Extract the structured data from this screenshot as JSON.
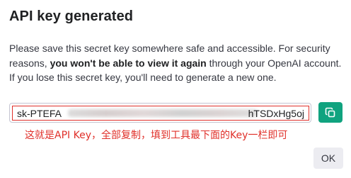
{
  "dialog": {
    "title": "API key generated",
    "description": {
      "part1": "Please save this secret key somewhere safe and accessible. For security reasons, ",
      "bold": "you won't be able to view it again",
      "part2": " through your OpenAI account. If you lose this secret key, you'll need to generate a new one."
    },
    "key": {
      "visible_prefix": "sk-PTEFA",
      "visible_suffix": "hTSDxHg5oj",
      "redacted": true
    },
    "copy_button": {
      "icon": "copy-icon"
    },
    "annotation": "这就是API Key，全部复制，填到工具最下面的Key一栏即可",
    "ok_label": "OK"
  },
  "colors": {
    "accent": "#10a37f",
    "highlight_red": "#e0302a",
    "title": "#202123",
    "body_text": "#353740",
    "button_gray": "#ececf1"
  }
}
